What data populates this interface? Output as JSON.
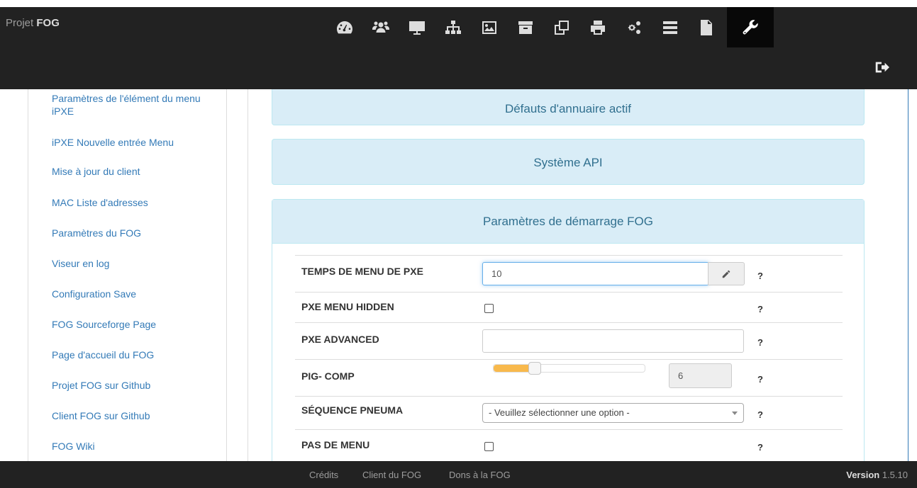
{
  "brand": {
    "prefix": "Projet",
    "name": "FOG"
  },
  "nav_icons": [
    "dashboard-icon",
    "users-icon",
    "monitor-icon",
    "sitemap-icon",
    "image-icon",
    "archive-icon",
    "clone-icon",
    "print-icon",
    "cogs-icon",
    "tasks-icon",
    "file-icon",
    "wrench-icon"
  ],
  "active_nav_icon": "wrench-icon",
  "logout_icon": "sign-out-icon",
  "sidebar": {
    "items": [
      {
        "label": "Paramètres de l'élément du menu iPXE"
      },
      {
        "label": "iPXE Nouvelle entrée Menu"
      },
      {
        "label": "Mise à jour du client"
      },
      {
        "label": "MAC Liste d'adresses"
      },
      {
        "label": "Paramètres du FOG"
      },
      {
        "label": "Viseur en log"
      },
      {
        "label": "Configuration Save"
      },
      {
        "label": "FOG Sourceforge Page"
      },
      {
        "label": "Page d'accueil du FOG"
      },
      {
        "label": "Projet FOG sur Github"
      },
      {
        "label": "Client FOG sur Github"
      },
      {
        "label": "FOG Wiki"
      }
    ]
  },
  "panels": {
    "directory": "Défauts d'annuaire actif",
    "api": "Système API",
    "boot": "Paramètres de démarrage FOG"
  },
  "settings": {
    "pxe_menu_time": {
      "label": "TEMPS DE MENU DE PXE",
      "value": "10",
      "help": "?"
    },
    "pxe_menu_hidden": {
      "label": "PXE MENU HIDDEN",
      "checked": false,
      "help": "?"
    },
    "pxe_advanced": {
      "label": "PXE ADVANCED",
      "value": "",
      "help": "?"
    },
    "pig_comp": {
      "label": "PIG- COMP",
      "value": "6",
      "slider_fraction": 0.27,
      "help": "?"
    },
    "pneuma_sequence": {
      "label": "SÉQUENCE PNEUMA",
      "selected": "- Veuillez sélectionner une option -",
      "help": "?"
    },
    "no_menu": {
      "label": "PAS DE MENU",
      "checked": false,
      "help": "?"
    }
  },
  "footer": {
    "credits": "Crédits",
    "client": "Client du FOG",
    "donate": "Dons à la FOG",
    "version_label": "Version",
    "version_number": "1.5.10"
  },
  "colors": {
    "navbar": "#222222",
    "panel_bg": "#d9edf7",
    "panel_text": "#31708f",
    "link": "#337ab7",
    "slider": "#f8b94c"
  }
}
